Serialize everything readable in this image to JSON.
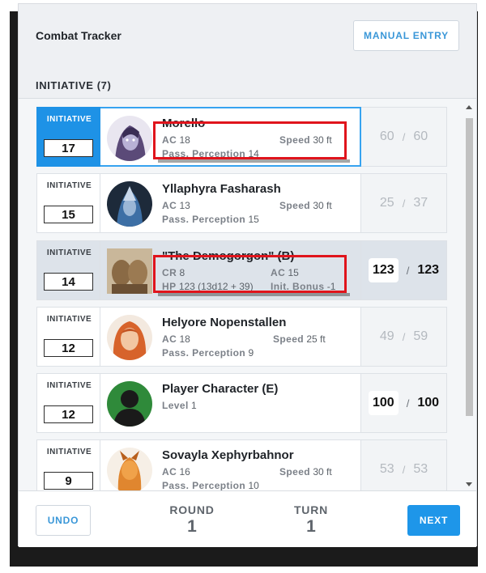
{
  "header": {
    "title": "Combat Tracker",
    "manual_entry_label": "MANUAL ENTRY"
  },
  "section_title": "INITIATIVE (7)",
  "initiative_label": "INITIATIVE",
  "hp_separator": "/",
  "combatants": [
    {
      "name": "Morello",
      "initiative": "17",
      "ac_label": "AC",
      "ac": "18",
      "speed_label": "Speed",
      "speed": "30 ft",
      "perception_label": "Pass. Perception",
      "perception": "14",
      "hp_current": "60",
      "hp_max": "60",
      "avatar": "purple-hooded-portrait"
    },
    {
      "name": "Yllaphyra Fasharash",
      "initiative": "15",
      "ac_label": "AC",
      "ac": "13",
      "speed_label": "Speed",
      "speed": "30 ft",
      "perception_label": "Pass. Perception",
      "perception": "15",
      "hp_current": "25",
      "hp_max": "37",
      "avatar": "blue-helmet-portrait"
    },
    {
      "name": "\"The Demogorgon\" (B)",
      "initiative": "14",
      "cr_label": "CR",
      "cr": "8",
      "ac_label": "AC",
      "ac": "15",
      "hp_label": "HP",
      "hp_formula": "123 (13d12 + 39)",
      "init_bonus_label": "Init. Bonus",
      "init_bonus": "-1",
      "hp_current": "123",
      "hp_max": "123",
      "avatar": "demogorgon-portrait"
    },
    {
      "name": "Helyore Nopenstallen",
      "initiative": "12",
      "ac_label": "AC",
      "ac": "18",
      "speed_label": "Speed",
      "speed": "25 ft",
      "perception_label": "Pass. Perception",
      "perception": "9",
      "hp_current": "49",
      "hp_max": "59",
      "avatar": "red-haired-portrait"
    },
    {
      "name": "Player Character (E)",
      "initiative": "12",
      "level_label": "Level",
      "level": "1",
      "hp_current": "100",
      "hp_max": "100",
      "avatar": "silhouette-portrait"
    },
    {
      "name": "Sovayla Xephyrbahnor",
      "initiative": "9",
      "ac_label": "AC",
      "ac": "16",
      "speed_label": "Speed",
      "speed": "30 ft",
      "perception_label": "Pass. Perception",
      "perception": "10",
      "hp_current": "53",
      "hp_max": "53",
      "avatar": "orange-dragonborn-portrait"
    }
  ],
  "footer": {
    "undo_label": "UNDO",
    "round_label": "ROUND",
    "round": "1",
    "turn_label": "TURN",
    "turn": "1",
    "next_label": "NEXT"
  },
  "colors": {
    "accent": "#1e96e9",
    "active_border": "#36a3f0",
    "highlight": "#e0141c"
  }
}
